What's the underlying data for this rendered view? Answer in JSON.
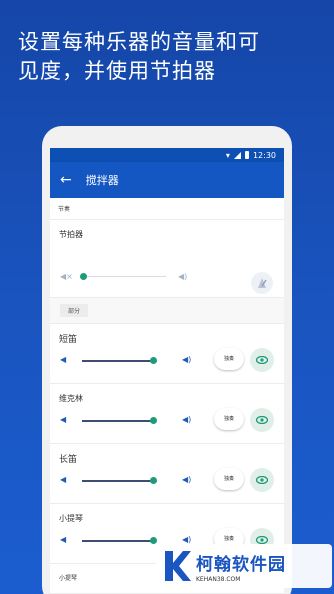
{
  "headline": {
    "line1": "设置每种乐器的音量和可",
    "line2": "见度，并使用节拍器"
  },
  "status_bar": {
    "time": "12:30"
  },
  "app_bar": {
    "title": "搅拌器"
  },
  "tempo_label": "节奏",
  "metronome": {
    "label": "节拍器",
    "volume": 0.0
  },
  "parts_label": "部分",
  "instruments": [
    {
      "name": "短笛",
      "volume": 0.92,
      "solo_label": "独奏"
    },
    {
      "name": "维克林",
      "volume": 0.92,
      "solo_label": "独奏"
    },
    {
      "name": "长笛",
      "volume": 0.92,
      "solo_label": "独奏"
    },
    {
      "name": "小提琴",
      "volume": 0.92,
      "solo_label": "独奏"
    },
    {
      "name": "小提琴"
    }
  ],
  "watermark": {
    "title": "柯翰软件园",
    "subtitle": "KEHAN38.COM"
  },
  "colors": {
    "background": "#1a55c0",
    "app_bar": "#1457c2",
    "slider_knob": "#1f9b7a",
    "eye_icon": "#1f9b7a"
  }
}
